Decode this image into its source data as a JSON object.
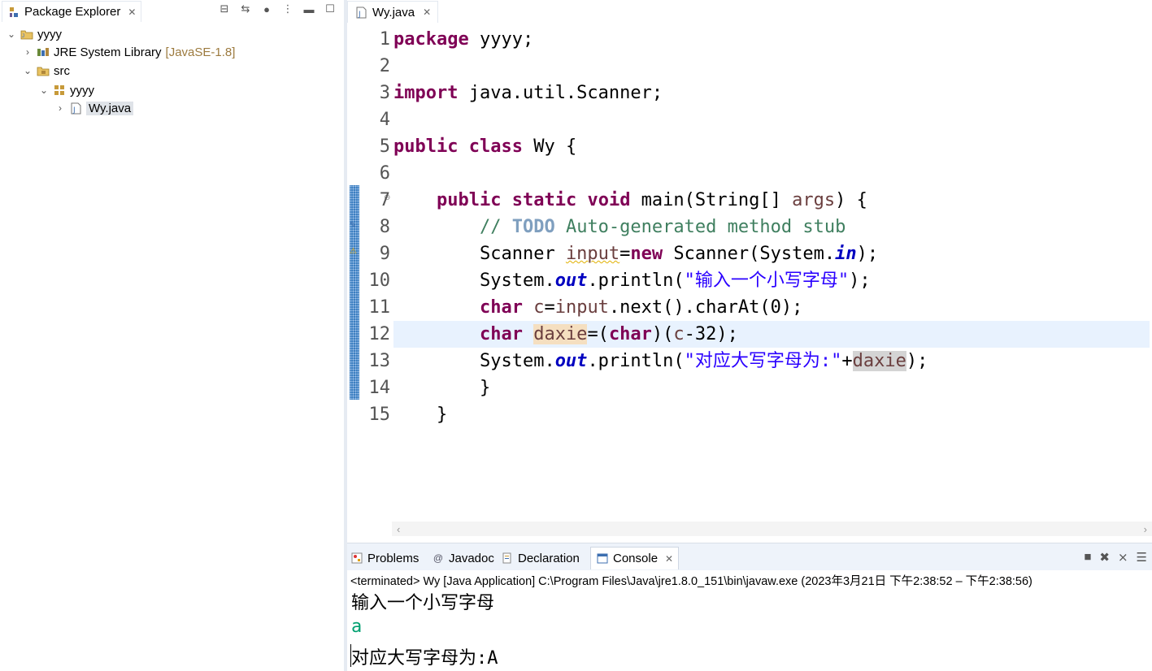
{
  "package_explorer": {
    "title": "Package Explorer",
    "tree": {
      "project": "yyyy",
      "jre_label": "JRE System Library",
      "jre_version": "[JavaSE-1.8]",
      "src": "src",
      "package": "yyyy",
      "file": "Wy.java"
    }
  },
  "editor": {
    "tab_title": "Wy.java",
    "line_numbers": [
      "1",
      "2",
      "3",
      "4",
      "5",
      "6",
      "7",
      "8",
      "9",
      "10",
      "11",
      "12",
      "13",
      "14",
      "15"
    ],
    "code": {
      "l1_kw": "package",
      "l1_rest": " yyyy;",
      "l3_kw": "import",
      "l3_rest": " java.util.Scanner;",
      "l5_kw1": "public",
      "l5_kw2": "class",
      "l5_rest": " Wy {",
      "l7_indent": "    ",
      "l7_kw1": "public",
      "l7_kw2": "static",
      "l7_kw3": "void",
      "l7_a": " main(String[] ",
      "l7_var": "args",
      "l7_b": ") {",
      "l8_indent": "        ",
      "l8_a": "// ",
      "l8_todo": "TODO",
      "l8_b": " Auto-generated method stub",
      "l9_indent": "        ",
      "l9_a": "Scanner ",
      "l9_var": "input",
      "l9_b": "=",
      "l9_kw": "new",
      "l9_c": " Scanner(System.",
      "l9_fld": "in",
      "l9_d": ");",
      "l10_indent": "        ",
      "l10_a": "System.",
      "l10_fld": "out",
      "l10_b": ".println(",
      "l10_str": "\"输入一个小写字母\"",
      "l10_c": ");",
      "l11_indent": "        ",
      "l11_kw": "char",
      "l11_sp": " ",
      "l11_var": "c",
      "l11_b": "=",
      "l11_var2": "input",
      "l11_c": ".next().charAt(0);",
      "l12_indent": "        ",
      "l12_kw": "char",
      "l12_sp": " ",
      "l12_var": "daxie",
      "l12_b": "=(",
      "l12_kw2": "char",
      "l12_c": ")(",
      "l12_var2": "c",
      "l12_d": "-32);",
      "l13_indent": "        ",
      "l13_a": "System.",
      "l13_fld": "out",
      "l13_b": ".println(",
      "l13_str": "\"对应大写字母为:\"",
      "l13_c": "+",
      "l13_var": "daxie",
      "l13_d": ");",
      "l14": "        }",
      "l15": "    }"
    }
  },
  "console": {
    "tabs": {
      "problems": "Problems",
      "javadoc": "Javadoc",
      "declaration": "Declaration",
      "console": "Console"
    },
    "status": "<terminated> Wy [Java Application] C:\\Program Files\\Java\\jre1.8.0_151\\bin\\javaw.exe  (2023年3月21日 下午2:38:52 – 下午2:38:56)",
    "output": {
      "line1": "输入一个小写字母",
      "line2": "a",
      "line3": "对应大写字母为:A"
    }
  },
  "colors": {
    "keyword": "#7f0055",
    "comment": "#3f7f5f",
    "string": "#2a00ff",
    "field": "#0000c0",
    "user_input": "#00a070",
    "current_line": "#e8f2fe"
  }
}
